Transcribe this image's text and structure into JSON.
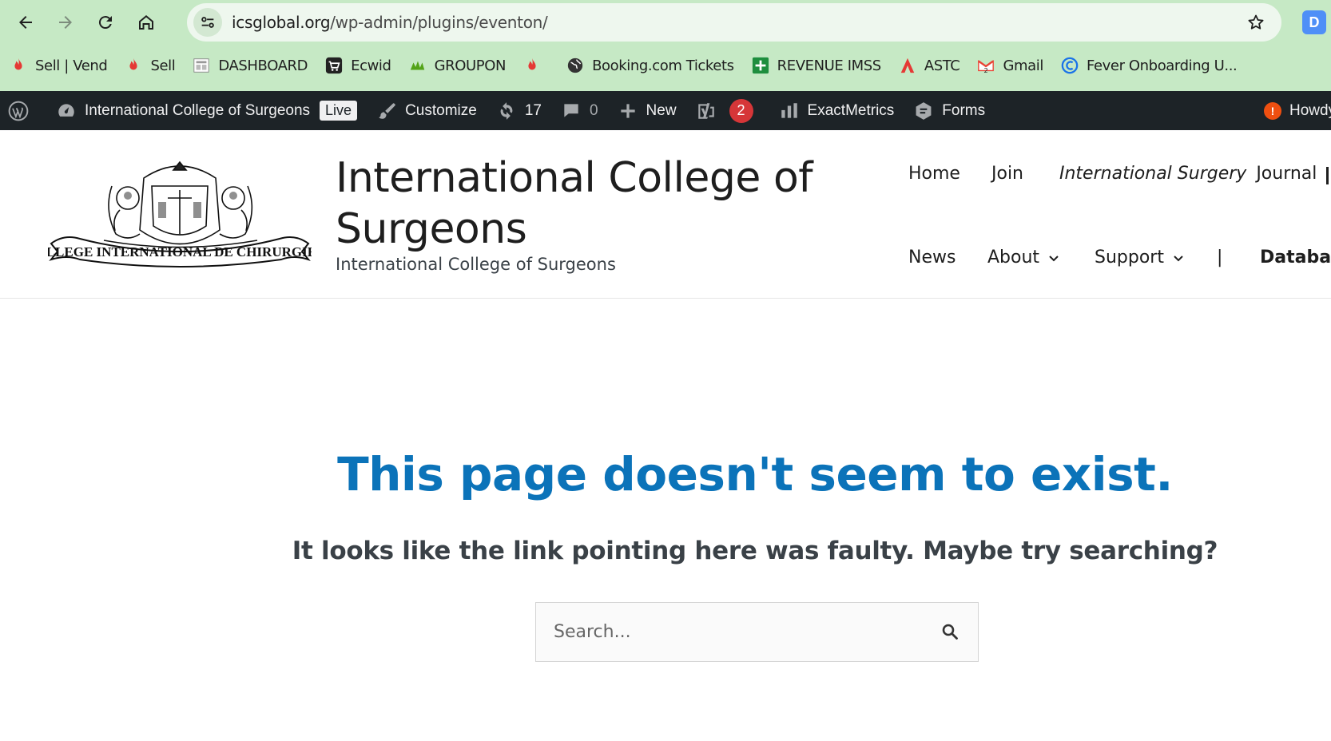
{
  "browser": {
    "url_host": "icsglobal.org",
    "url_path": "/wp-admin/plugins/eventon/",
    "profile_initial": "D",
    "bookmarks": [
      {
        "label": "Sell | Vend",
        "icon": "flame-icon"
      },
      {
        "label": "Sell",
        "icon": "flame-icon"
      },
      {
        "label": "DASHBOARD",
        "icon": "dashboard-icon"
      },
      {
        "label": "Ecwid",
        "icon": "cart-icon"
      },
      {
        "label": "GROUPON",
        "icon": "groupon-icon"
      },
      {
        "label": "",
        "icon": "flame-icon"
      },
      {
        "label": "Booking.com Tickets",
        "icon": "globe-icon"
      },
      {
        "label": "REVENUE IMSS",
        "icon": "plus-box-icon"
      },
      {
        "label": "ASTC",
        "icon": "astc-icon"
      },
      {
        "label": "Gmail",
        "icon": "gmail-icon"
      },
      {
        "label": "Fever Onboarding U...",
        "icon": "fever-icon"
      }
    ]
  },
  "adminbar": {
    "site_name": "International College of Surgeons",
    "live_label": "Live",
    "customize_label": "Customize",
    "updates_count": "17",
    "comments_count": "0",
    "new_label": "New",
    "yoast_count": "2",
    "exactmetrics_label": "ExactMetrics",
    "forms_label": "Forms",
    "howdy_label": "Howdy"
  },
  "header": {
    "site_title": "International College of Surgeons",
    "tagline": "International College of Surgeons",
    "logo_text": "COLLEGE INTERNATIONAL DE CHIRURGIENS",
    "menu": {
      "home": "Home",
      "join": "Join",
      "international_surgery": "International Surgery",
      "journal": "Journal",
      "news": "News",
      "about": "About",
      "support": "Support",
      "separator": "|",
      "database": "Database"
    }
  },
  "main": {
    "heading": "This page doesn't seem to exist.",
    "subheading": "It looks like the link pointing here was faulty. Maybe try searching?",
    "search_placeholder": "Search..."
  },
  "colors": {
    "chrome_bg": "#c6e9c5",
    "adminbar_bg": "#1d2327",
    "heading_blue": "#0b73b9",
    "badge_red": "#d63638"
  }
}
